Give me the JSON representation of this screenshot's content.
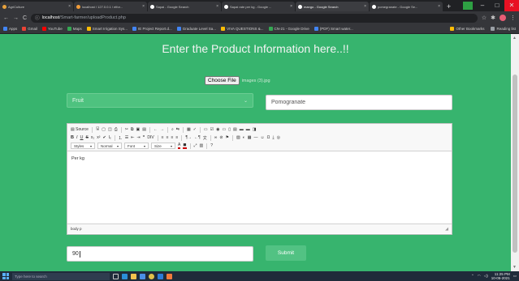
{
  "browser": {
    "tabs": [
      {
        "title": "AgriCulture",
        "color": "#e8a23c",
        "active": false
      },
      {
        "title": "localhost / 127.0.0.1 / elfor...",
        "color": "#f29c38",
        "active": false
      },
      {
        "title": "Sapai - Google Search",
        "color": "#ffffff",
        "active": false
      },
      {
        "title": "Sapai rate per kg - Google ...",
        "color": "#ffffff",
        "active": false
      },
      {
        "title": "mango - Google Search",
        "color": "#ffffff",
        "active": true
      },
      {
        "title": "pomegranate - Google Se...",
        "color": "#ffffff",
        "active": false
      }
    ],
    "new_tab": "+",
    "url_host": "localhost",
    "url_path": "/Smart-farmer/uploadProduct.php",
    "bookmarks": [
      {
        "label": "Apps",
        "color": "#4285f4"
      },
      {
        "label": "Gmail",
        "color": "#ea4335"
      },
      {
        "label": "YouTube",
        "color": "#ff0000"
      },
      {
        "label": "Maps",
        "color": "#34a853"
      },
      {
        "label": "Smart Irrigation Sys...",
        "color": "#fbbc05"
      },
      {
        "label": "IE Project Report.d...",
        "color": "#4285f4"
      },
      {
        "label": "Graduate Level Sa...",
        "color": "#4285f4"
      },
      {
        "label": "VIVA QUESTIONS &...",
        "color": "#fbbc05"
      },
      {
        "label": "CN-21 - Google Drive",
        "color": "#34a853"
      },
      {
        "label": "(PDF) Smart water...",
        "color": "#4285f4"
      }
    ],
    "other_bookmarks": "Other Bookmarks",
    "reading_list": "Reading list"
  },
  "page": {
    "heading": "Enter the Product Information here..!!",
    "file_button": "Choose File",
    "file_name": "images (3).jpg",
    "category_select": "Fruit",
    "product_name_value": "Pomogranate",
    "editor": {
      "toolbar_row1": [
        "Source",
        "|",
        "Save",
        "New",
        "Preview",
        "Print",
        "|",
        "Cut",
        "Copy",
        "Paste",
        "Paste Text",
        "|",
        "Undo",
        "Redo",
        "|",
        "Find",
        "Replace",
        "|",
        "Select All",
        "Spell"
      ],
      "toolbar_row2": [
        "B",
        "I",
        "U",
        "S",
        "x₂",
        "x²",
        "✓",
        "Iₓ",
        "|",
        "1.",
        "•",
        "⇤",
        "⇥",
        "❞",
        "DIV",
        "|",
        "≡",
        "≡",
        "≡",
        "≡"
      ],
      "styles_label": "Styles",
      "format_label": "Normal",
      "font_label": "Font",
      "size_label": "Size",
      "content": "Per kg",
      "status_path": "body  p"
    },
    "price_value": "90",
    "submit_label": "Submit"
  },
  "taskbar": {
    "search_placeholder": "Type here to search",
    "time": "11:25 PM",
    "date": "10-05-2021"
  }
}
